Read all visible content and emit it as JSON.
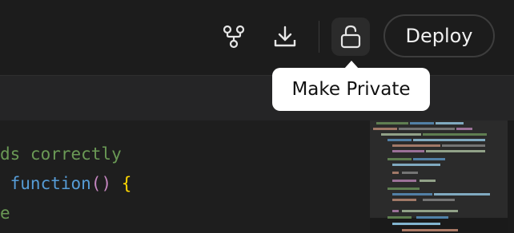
{
  "toolbar": {
    "fork_icon": "fork-icon",
    "download_icon": "download-icon",
    "lock_icon": "unlock-icon",
    "deploy_label": "Deploy"
  },
  "tooltip": {
    "text": "Make Private"
  },
  "editor": {
    "lines": [
      {
        "parts": [
          {
            "t": "ds correctly",
            "c": "cmt"
          }
        ]
      },
      {
        "parts": [
          {
            "t": " function",
            "c": "fn"
          },
          {
            "t": "()",
            "c": "paren"
          },
          {
            "t": " {",
            "c": "brace"
          }
        ]
      },
      {
        "parts": [
          {
            "t": "e",
            "c": "cmt"
          }
        ]
      }
    ]
  },
  "colors": {
    "background": "#1e1e1e",
    "tooltip_bg": "#ffffff",
    "comment": "#6a9955",
    "function": "#569cd6",
    "paren": "#c586c0",
    "brace": "#ffd700"
  }
}
